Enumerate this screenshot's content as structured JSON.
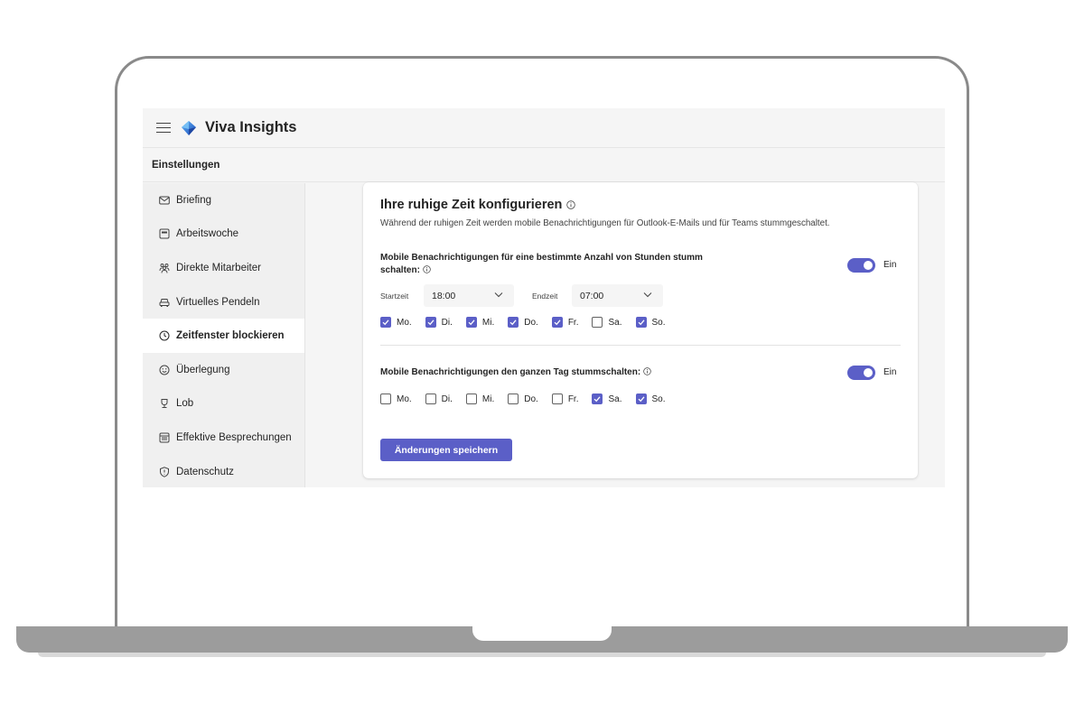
{
  "app": {
    "title": "Viva Insights"
  },
  "settings_bar": {
    "label": "Einstellungen"
  },
  "sidebar": {
    "items": [
      {
        "label": "Briefing",
        "icon": "mail-icon",
        "active": false
      },
      {
        "label": "Arbeitswoche",
        "icon": "calendar-icon",
        "active": false
      },
      {
        "label": "Direkte Mitarbeiter",
        "icon": "people-icon",
        "active": false
      },
      {
        "label": "Virtuelles Pendeln",
        "icon": "car-icon",
        "active": false
      },
      {
        "label": "Zeitfenster blockieren",
        "icon": "clock-icon",
        "active": true
      },
      {
        "label": "Überlegung",
        "icon": "smile-icon",
        "active": false
      },
      {
        "label": "Lob",
        "icon": "trophy-icon",
        "active": false
      },
      {
        "label": "Effektive Besprechungen",
        "icon": "meeting-icon",
        "active": false
      },
      {
        "label": "Datenschutz",
        "icon": "shield-icon",
        "active": false
      }
    ]
  },
  "card": {
    "title": "Ihre ruhige Zeit konfigurieren",
    "subtitle": "Während der ruhigen Zeit werden mobile Benachrichtigungen für Outlook-E-Mails und für Teams stummgeschaltet.",
    "section1": {
      "title_line1": "Mobile Benachrichtigungen für eine bestimmte Anzahl von Stunden stumm",
      "title_line2": "schalten:",
      "toggle_label": "Ein",
      "toggle_on": true,
      "start_label": "Startzeit",
      "start_value": "18:00",
      "end_label": "Endzeit",
      "end_value": "07:00",
      "days": [
        {
          "label": "Mo.",
          "checked": true
        },
        {
          "label": "Di.",
          "checked": true
        },
        {
          "label": "Mi.",
          "checked": true
        },
        {
          "label": "Do.",
          "checked": true
        },
        {
          "label": "Fr.",
          "checked": true
        },
        {
          "label": "Sa.",
          "checked": false
        },
        {
          "label": "So.",
          "checked": true
        }
      ]
    },
    "section2": {
      "title": "Mobile Benachrichtigungen den ganzen Tag stummschalten:",
      "toggle_label": "Ein",
      "toggle_on": true,
      "days": [
        {
          "label": "Mo.",
          "checked": false
        },
        {
          "label": "Di.",
          "checked": false
        },
        {
          "label": "Mi.",
          "checked": false
        },
        {
          "label": "Do.",
          "checked": false
        },
        {
          "label": "Fr.",
          "checked": false
        },
        {
          "label": "Sa.",
          "checked": true
        },
        {
          "label": "So.",
          "checked": true
        }
      ]
    },
    "save_button": "Änderungen speichern"
  },
  "colors": {
    "accent": "#5b5fc7",
    "sidebar_bg": "#f0f0f0",
    "screen_bg": "#f5f5f5"
  }
}
